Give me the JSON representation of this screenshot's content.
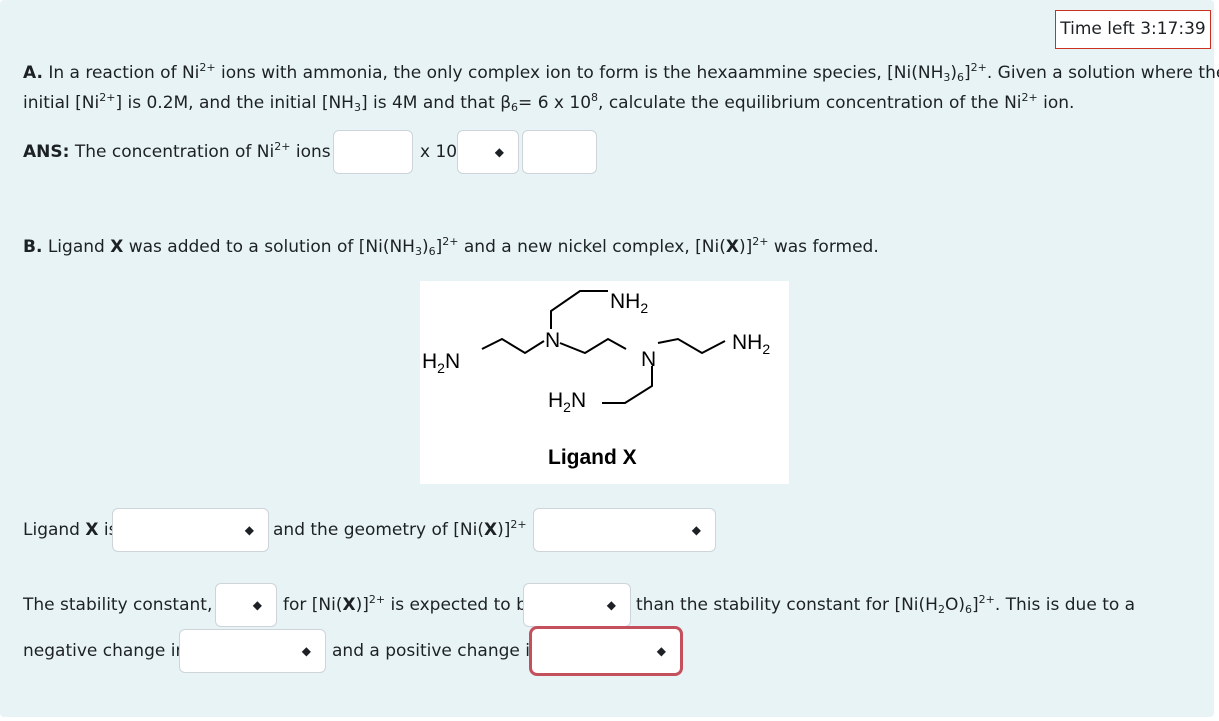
{
  "timer": {
    "label": "Time left 3:17:39"
  },
  "partA": {
    "letter": "A.",
    "line1_pre": "In a reaction of Ni",
    "ion_charge": "2+",
    "line1_mid": "ions with ammonia, the only complex ion to form is the hexaammine species, [Ni(NH",
    "sub3": "3",
    "sub6": "6",
    "close": ")",
    "bracket": "]",
    "line1_post": ". Given a solution where the",
    "line2_a": "initial [Ni",
    "line2_b": "] is 0.2M, and the initial [NH",
    "line2_c": "] is 4M and that β",
    "line2_d": "= 6 x 10",
    "exp8": "8",
    "line2_e": ", calculate the equilibrium concentration of the Ni",
    "line2_f": " ion.",
    "ans_label": "ANS:",
    "ans_text": "The concentration of Ni",
    "ans_text2": " ions is",
    "times_ten": "x 10"
  },
  "partB": {
    "letter": "B.",
    "text1": "Ligand ",
    "X": "X",
    "text2": " was added to a solution of [Ni(NH",
    "text3": " and a new nickel complex, [Ni(",
    "text4": ")]",
    "text5": " was formed."
  },
  "figure": {
    "labels": [
      "NH2",
      "N",
      "N",
      "NH2",
      "H2N",
      "H2N"
    ],
    "nh": "NH",
    "hn": "H",
    "n": "N",
    "two": "2",
    "caption": "Ligand X"
  },
  "row1": {
    "ligand_pre": "Ligand ",
    "is": " is",
    "geom_text": "and the geometry of [Ni(",
    "geom_text2": ")]",
    "geom_is": " is"
  },
  "row2": {
    "text1": "The stability constant, β",
    "text2": "for [Ni(",
    "text3": ")]",
    "text4": " is expected to be",
    "text5": "than the stability constant for [Ni(H",
    "text6": "O)",
    "text7": "]",
    "text8": ". This is due to a"
  },
  "row3": {
    "text1": "negative change in",
    "text2": "and a positive change in"
  },
  "charge2p": "2+"
}
